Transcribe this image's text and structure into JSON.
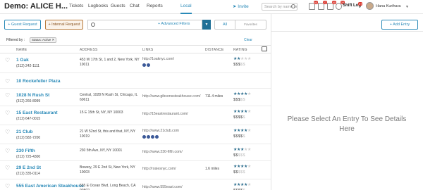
{
  "app": {
    "title": "Demo: ALICE H..."
  },
  "nav": {
    "items": [
      {
        "label": "Tickets"
      },
      {
        "label": "Logbooks"
      },
      {
        "label": "Guests"
      },
      {
        "label": "Chat"
      },
      {
        "label": "Reports"
      },
      {
        "label": "Local",
        "active": true
      }
    ],
    "invite": "Invite",
    "search_placeholder": "Search by name or",
    "badges": [
      "60",
      "27",
      "40",
      "20"
    ],
    "shift_log": "Shift Log",
    "shift_log_badge": "37",
    "user": "Hana Kurihara"
  },
  "toolbar": {
    "guest_request": "+ Guest Request",
    "internal_request": "+ Internal Request",
    "advanced_filters": "+ Advanced Filters",
    "tab_all": "All",
    "tab_favorites": "Favorites",
    "add_entry": "+ Add Entry"
  },
  "filters": {
    "label": "Filtered by :",
    "chip": "Status: Active ✕",
    "clear": "Clear"
  },
  "table": {
    "headers": {
      "name": "NAME",
      "address": "ADDRESS",
      "links": "LINKS",
      "distance": "DISTANCE",
      "rating": "RATING"
    },
    "rows": [
      {
        "name": "1 Oak",
        "phone": "(212) 242-1111",
        "address": "453 W 17th St, 1 and 2, New York, NY 10011",
        "link": "http://1oaknyc.com/",
        "distance": "",
        "stars": 2,
        "price": 3,
        "social": 2
      },
      {
        "name": "10 Rockefeller Plaza",
        "phone": "",
        "address": "",
        "link": "",
        "distance": "",
        "stars": 0,
        "price": 0,
        "social": 0
      },
      {
        "name": "1028 N Rush St",
        "phone": "(312) 266-8999",
        "address": "Central, 1028 N Rush St, Chicago, IL 60611",
        "link": "http://www.gibsonssteakhouse.com/",
        "distance": "711.4 miles",
        "stars": 4,
        "price": 3,
        "social": 0
      },
      {
        "name": "15 East Restaurant",
        "phone": "(212) 647-0015",
        "address": "15 E 15th St, NY, NY 10003",
        "link": "http://15eastrestaurant.com/",
        "distance": "",
        "stars": 4,
        "price": 4,
        "social": 0
      },
      {
        "name": "21 Club",
        "phone": "(212) 582-7200",
        "address": "21 W 52nd St, this and that, NY, NY 10019",
        "link": "http://www.21club.com",
        "distance": "",
        "stars": 4,
        "price": 4,
        "social": 4
      },
      {
        "name": "230 Fifth",
        "phone": "(212) 725-4300",
        "address": "230 5th Ave, NY, NY 10001",
        "link": "http://www.230-fifth.com/",
        "distance": "",
        "stars": 3,
        "price": 2,
        "social": 0
      },
      {
        "name": "29 E 2nd St",
        "phone": "(212) 335-0114",
        "address": "Bowery, 29 E 2nd St, New York, NY 10003",
        "link": "http://rosiesnyc.com/",
        "distance": "1.6 miles",
        "stars": 4,
        "price": 2,
        "social": 0
      },
      {
        "name": "555 East American Steakhouse",
        "phone": "(562) 437-0626",
        "address": "555 E Ocean Blvd, Long Beach, CA 90802",
        "link": "http://www.555east.com/",
        "distance": "",
        "stars": 4,
        "price": 4,
        "social": 0
      }
    ]
  },
  "detail": {
    "placeholder": "Please Select An Entry To See Details Here"
  }
}
